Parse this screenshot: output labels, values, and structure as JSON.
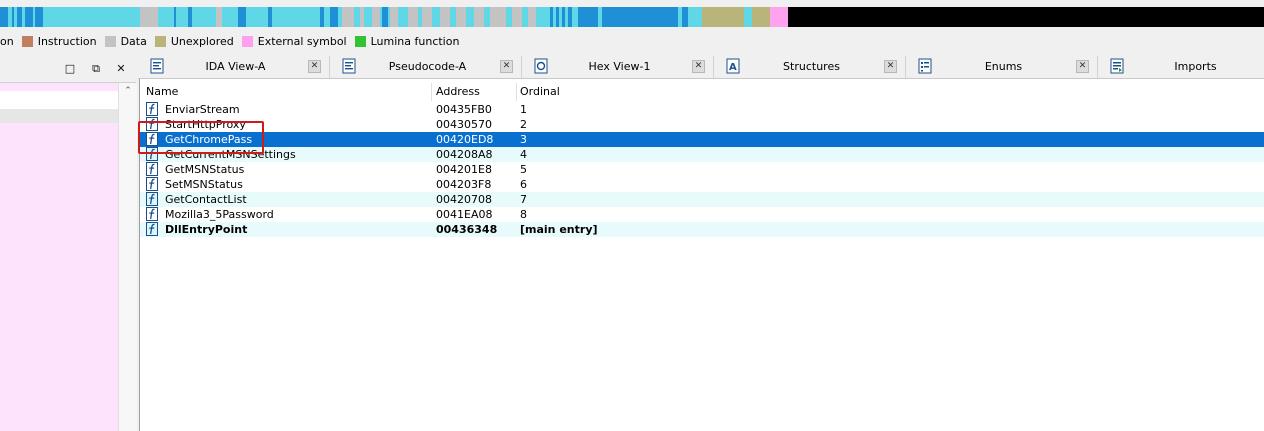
{
  "navigation_band": {
    "colors": {
      "blue": "#1f8fd6",
      "cyan": "#5fd7e6",
      "gray": "#c3c3c3",
      "olive": "#b9b57a",
      "pink": "#ffa3f0",
      "black": "#000000"
    }
  },
  "legend": [
    {
      "label": "on",
      "color": "#3a78ce"
    },
    {
      "label": "Instruction",
      "color": "#c08060"
    },
    {
      "label": "Data",
      "color": "#c3c3c3"
    },
    {
      "label": "Unexplored",
      "color": "#b9b57a"
    },
    {
      "label": "External symbol",
      "color": "#ff9ff0"
    },
    {
      "label": "Lumina function",
      "color": "#33c233"
    }
  ],
  "left_panel": {
    "buttons": [
      {
        "name": "maximize-button",
        "icon": "maximize-icon",
        "glyph": "□"
      },
      {
        "name": "float-button",
        "icon": "float-window-icon",
        "glyph": "⧉"
      },
      {
        "name": "close-button",
        "icon": "close-icon",
        "glyph": "✕"
      }
    ],
    "scroll_up_glyph": "⌃"
  },
  "tabs": [
    {
      "label": "IDA View-A",
      "icon": "ida-view-icon",
      "close": "✕"
    },
    {
      "label": "Pseudocode-A",
      "icon": "pseudocode-icon",
      "close": "✕"
    },
    {
      "label": "Hex View-1",
      "icon": "hex-view-icon",
      "close": "✕"
    },
    {
      "label": "Structures",
      "icon": "structures-icon",
      "close": "✕"
    },
    {
      "label": "Enums",
      "icon": "enums-icon",
      "close": "✕"
    },
    {
      "label": "Imports",
      "icon": "imports-icon",
      "close": "✕"
    }
  ],
  "columns": {
    "name": "Name",
    "address": "Address",
    "ordinal": "Ordinal"
  },
  "exports": [
    {
      "name": "EnviarStream",
      "address": "00435FB0",
      "ordinal": "1",
      "icon": "function-icon",
      "style": "plain"
    },
    {
      "name": "StartHttpProxy",
      "address": "00430570",
      "ordinal": "2",
      "icon": "function-icon",
      "style": "plain"
    },
    {
      "name": "GetChromePass",
      "address": "00420ED8",
      "ordinal": "3",
      "icon": "function-icon",
      "style": "selected"
    },
    {
      "name": "GetCurrentMSNSettings",
      "address": "004208A8",
      "ordinal": "4",
      "icon": "lumina-function-icon",
      "style": "alt"
    },
    {
      "name": "GetMSNStatus",
      "address": "004201E8",
      "ordinal": "5",
      "icon": "function-icon",
      "style": "plain"
    },
    {
      "name": "SetMSNStatus",
      "address": "004203F8",
      "ordinal": "6",
      "icon": "function-icon",
      "style": "plain"
    },
    {
      "name": "GetContactList",
      "address": "00420708",
      "ordinal": "7",
      "icon": "lumina-function-icon",
      "style": "alt"
    },
    {
      "name": "Mozilla3_5Password",
      "address": "0041EA08",
      "ordinal": "8",
      "icon": "function-icon",
      "style": "plain"
    },
    {
      "name": "DllEntryPoint",
      "address": "00436348",
      "ordinal": "[main entry]",
      "icon": "lumina-function-icon",
      "style": "alt-bold"
    }
  ],
  "annotation": {
    "color": "#d11a1a"
  }
}
